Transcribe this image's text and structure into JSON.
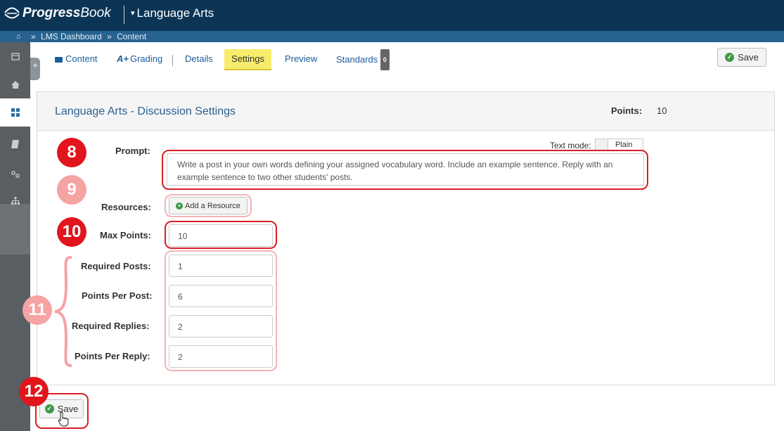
{
  "header": {
    "brand_bold": "Progress",
    "brand_light": "Book",
    "course_menu": "Language Arts"
  },
  "breadcrumb": {
    "items": [
      "LMS Dashboard",
      "Content"
    ],
    "separator": "»"
  },
  "tabs": [
    {
      "label": "Content",
      "icon": "folder-icon"
    },
    {
      "label": "Grading",
      "icon": "grade-icon"
    },
    {
      "label": "Details"
    },
    {
      "label": "Settings",
      "selected": true
    },
    {
      "label": "Preview"
    },
    {
      "label": "Standards",
      "badge": "0"
    }
  ],
  "toolbar": {
    "save_label": "Save"
  },
  "panel": {
    "title": "Language Arts - Discussion Settings",
    "points_label": "Points:",
    "points_value": "10"
  },
  "form": {
    "prompt_label": "Prompt:",
    "text_mode_label": "Text mode:",
    "text_mode_value": "Plain",
    "prompt_value": "Write a post in your own words defining your assigned vocabulary word. Include an example sentence. Reply with an example sentence to two other students' posts.",
    "resources_label": "Resources:",
    "add_resource_label": "Add a Resource",
    "max_points_label": "Max Points:",
    "max_points_value": "10",
    "required_posts_label": "Required Posts:",
    "required_posts_value": "1",
    "points_per_post_label": "Points Per Post:",
    "points_per_post_value": "6",
    "required_replies_label": "Required Replies:",
    "required_replies_value": "2",
    "points_per_reply_label": "Points Per Reply:",
    "points_per_reply_value": "2"
  },
  "bottom": {
    "save_label": "Save"
  },
  "callouts": {
    "c8": "8",
    "c9": "9",
    "c10": "10",
    "c11": "11",
    "c12": "12"
  },
  "colors": {
    "header": "#0b3455",
    "breadcrumb": "#27628f",
    "rail": "#595e63",
    "selected_tab": "#f8ec6c",
    "link": "#1a5d9c",
    "callout_dark": "#e1151c",
    "callout_light": "#f6a3a4",
    "check": "#3d9a48"
  }
}
